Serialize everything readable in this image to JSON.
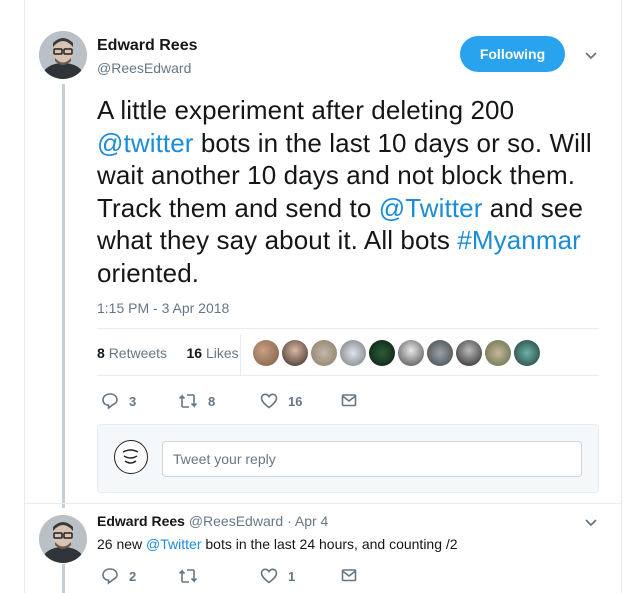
{
  "main_tweet": {
    "author_name": "Edward Rees",
    "author_handle": "@ReesEdward",
    "follow_label": "Following",
    "text": {
      "p1": "A little experiment after deleting 200",
      "p2": "@twitter",
      "p3": " bots in the last 10 days or so. Will wait another 10 days and not block them. Track them and send to ",
      "p4": "@Twitter",
      "p5": " and see what they say about it. All bots ",
      "p6": "#Myanmar",
      "p7": " oriented."
    },
    "timestamp": "1:15 PM - 3 Apr 2018",
    "retweets_count": "8",
    "retweets_label": "Retweets",
    "likes_count": "16",
    "likes_label": "Likes",
    "actions": {
      "replies": "3",
      "retweets": "8",
      "likes": "16"
    }
  },
  "reply_box": {
    "placeholder": "Tweet your reply"
  },
  "reply_tweet": {
    "author_name": "Edward Rees",
    "author_handle": "@ReesEdward",
    "date": "· Apr 4",
    "text_before": "26 new ",
    "mention": "@Twitter",
    "text_after": " bots in the last 24 hours, and counting /2",
    "actions": {
      "replies": "2",
      "retweets": "",
      "likes": "1"
    }
  },
  "colors": {
    "accent": "#1da1f2",
    "link": "#1b95e0",
    "muted": "#657786",
    "thread_line": "#c4cfd6"
  }
}
